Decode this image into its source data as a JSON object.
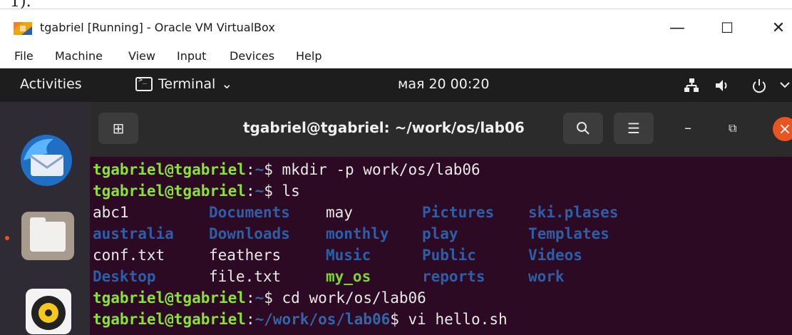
{
  "fragment": "1).",
  "window": {
    "title": "tgabriel [Running] - Oracle VM VirtualBox",
    "minimize_symbol": "—",
    "maximize_symbol": "☐",
    "close_symbol": "✕"
  },
  "menu": [
    "File",
    "Machine",
    "View",
    "Input",
    "Devices",
    "Help"
  ],
  "gnome": {
    "activities": "Activities",
    "app_menu": "Terminal",
    "app_menu_caret": "⌄",
    "clock": "мая 20  00:20",
    "tray_icons": [
      "network-icon",
      "volume-icon",
      "power-icon",
      "chevron-down-icon"
    ]
  },
  "dock": {
    "apps": [
      "thunderbird-icon",
      "files-icon",
      "rhythmbox-icon"
    ]
  },
  "terminal": {
    "title": "tgabriel@tgabriel: ~/work/os/lab06",
    "new_tab_symbol": "⊞",
    "search_symbol": "⌕",
    "menu_symbol": "☰",
    "minimize_symbol": "–",
    "restore_symbol": "⧉",
    "close_symbol": "×",
    "lines": [
      {
        "user": "tgabriel@tgabriel",
        "sep": ":",
        "path": "~",
        "cmd": "$ mkdir -p work/os/lab06"
      },
      {
        "user": "tgabriel@tgabriel",
        "sep": ":",
        "path": "~",
        "cmd": "$ ls"
      }
    ],
    "ls_rows": [
      [
        {
          "name": "abc1",
          "kind": "plain"
        },
        {
          "name": "Documents",
          "kind": "dir"
        },
        {
          "name": "may",
          "kind": "plain"
        },
        {
          "name": "Pictures",
          "kind": "dir"
        },
        {
          "name": "ski.plases",
          "kind": "dir"
        }
      ],
      [
        {
          "name": "australia",
          "kind": "dir"
        },
        {
          "name": "Downloads",
          "kind": "dir"
        },
        {
          "name": "monthly",
          "kind": "dir"
        },
        {
          "name": "play",
          "kind": "dir"
        },
        {
          "name": "Templates",
          "kind": "dir"
        }
      ],
      [
        {
          "name": "conf.txt",
          "kind": "plain"
        },
        {
          "name": "feathers",
          "kind": "plain"
        },
        {
          "name": "Music",
          "kind": "dir"
        },
        {
          "name": "Public",
          "kind": "dir"
        },
        {
          "name": "Videos",
          "kind": "dir"
        }
      ],
      [
        {
          "name": "Desktop",
          "kind": "dir"
        },
        {
          "name": "file.txt",
          "kind": "plain"
        },
        {
          "name": "my_os",
          "kind": "exe"
        },
        {
          "name": "reports",
          "kind": "dir"
        },
        {
          "name": "work",
          "kind": "dir"
        }
      ]
    ],
    "after_lines": [
      {
        "user": "tgabriel@tgabriel",
        "sep": ":",
        "path": "~",
        "cmd": "$ cd work/os/lab06"
      },
      {
        "user": "tgabriel@tgabriel",
        "sep": ":",
        "path": "~/work/os/lab06",
        "cmd": "$ vi hello.sh"
      }
    ]
  },
  "colors": {
    "terminal_bg": "#2c0a23",
    "prompt_user": "#8ae234",
    "prompt_path": "#3465a4",
    "directory": "#2d5ea8",
    "accent_close": "#e95420"
  }
}
